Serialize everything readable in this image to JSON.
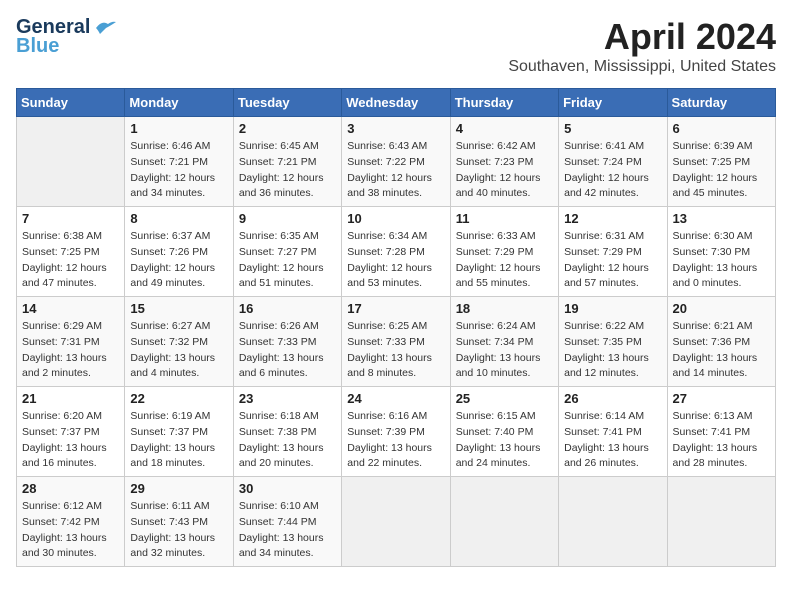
{
  "logo": {
    "line1": "General",
    "line2": "Blue"
  },
  "title": "April 2024",
  "subtitle": "Southaven, Mississippi, United States",
  "weekdays": [
    "Sunday",
    "Monday",
    "Tuesday",
    "Wednesday",
    "Thursday",
    "Friday",
    "Saturday"
  ],
  "weeks": [
    [
      {
        "day": "",
        "sunrise": "",
        "sunset": "",
        "daylight": ""
      },
      {
        "day": "1",
        "sunrise": "Sunrise: 6:46 AM",
        "sunset": "Sunset: 7:21 PM",
        "daylight": "Daylight: 12 hours and 34 minutes."
      },
      {
        "day": "2",
        "sunrise": "Sunrise: 6:45 AM",
        "sunset": "Sunset: 7:21 PM",
        "daylight": "Daylight: 12 hours and 36 minutes."
      },
      {
        "day": "3",
        "sunrise": "Sunrise: 6:43 AM",
        "sunset": "Sunset: 7:22 PM",
        "daylight": "Daylight: 12 hours and 38 minutes."
      },
      {
        "day": "4",
        "sunrise": "Sunrise: 6:42 AM",
        "sunset": "Sunset: 7:23 PM",
        "daylight": "Daylight: 12 hours and 40 minutes."
      },
      {
        "day": "5",
        "sunrise": "Sunrise: 6:41 AM",
        "sunset": "Sunset: 7:24 PM",
        "daylight": "Daylight: 12 hours and 42 minutes."
      },
      {
        "day": "6",
        "sunrise": "Sunrise: 6:39 AM",
        "sunset": "Sunset: 7:25 PM",
        "daylight": "Daylight: 12 hours and 45 minutes."
      }
    ],
    [
      {
        "day": "7",
        "sunrise": "Sunrise: 6:38 AM",
        "sunset": "Sunset: 7:25 PM",
        "daylight": "Daylight: 12 hours and 47 minutes."
      },
      {
        "day": "8",
        "sunrise": "Sunrise: 6:37 AM",
        "sunset": "Sunset: 7:26 PM",
        "daylight": "Daylight: 12 hours and 49 minutes."
      },
      {
        "day": "9",
        "sunrise": "Sunrise: 6:35 AM",
        "sunset": "Sunset: 7:27 PM",
        "daylight": "Daylight: 12 hours and 51 minutes."
      },
      {
        "day": "10",
        "sunrise": "Sunrise: 6:34 AM",
        "sunset": "Sunset: 7:28 PM",
        "daylight": "Daylight: 12 hours and 53 minutes."
      },
      {
        "day": "11",
        "sunrise": "Sunrise: 6:33 AM",
        "sunset": "Sunset: 7:29 PM",
        "daylight": "Daylight: 12 hours and 55 minutes."
      },
      {
        "day": "12",
        "sunrise": "Sunrise: 6:31 AM",
        "sunset": "Sunset: 7:29 PM",
        "daylight": "Daylight: 12 hours and 57 minutes."
      },
      {
        "day": "13",
        "sunrise": "Sunrise: 6:30 AM",
        "sunset": "Sunset: 7:30 PM",
        "daylight": "Daylight: 13 hours and 0 minutes."
      }
    ],
    [
      {
        "day": "14",
        "sunrise": "Sunrise: 6:29 AM",
        "sunset": "Sunset: 7:31 PM",
        "daylight": "Daylight: 13 hours and 2 minutes."
      },
      {
        "day": "15",
        "sunrise": "Sunrise: 6:27 AM",
        "sunset": "Sunset: 7:32 PM",
        "daylight": "Daylight: 13 hours and 4 minutes."
      },
      {
        "day": "16",
        "sunrise": "Sunrise: 6:26 AM",
        "sunset": "Sunset: 7:33 PM",
        "daylight": "Daylight: 13 hours and 6 minutes."
      },
      {
        "day": "17",
        "sunrise": "Sunrise: 6:25 AM",
        "sunset": "Sunset: 7:33 PM",
        "daylight": "Daylight: 13 hours and 8 minutes."
      },
      {
        "day": "18",
        "sunrise": "Sunrise: 6:24 AM",
        "sunset": "Sunset: 7:34 PM",
        "daylight": "Daylight: 13 hours and 10 minutes."
      },
      {
        "day": "19",
        "sunrise": "Sunrise: 6:22 AM",
        "sunset": "Sunset: 7:35 PM",
        "daylight": "Daylight: 13 hours and 12 minutes."
      },
      {
        "day": "20",
        "sunrise": "Sunrise: 6:21 AM",
        "sunset": "Sunset: 7:36 PM",
        "daylight": "Daylight: 13 hours and 14 minutes."
      }
    ],
    [
      {
        "day": "21",
        "sunrise": "Sunrise: 6:20 AM",
        "sunset": "Sunset: 7:37 PM",
        "daylight": "Daylight: 13 hours and 16 minutes."
      },
      {
        "day": "22",
        "sunrise": "Sunrise: 6:19 AM",
        "sunset": "Sunset: 7:37 PM",
        "daylight": "Daylight: 13 hours and 18 minutes."
      },
      {
        "day": "23",
        "sunrise": "Sunrise: 6:18 AM",
        "sunset": "Sunset: 7:38 PM",
        "daylight": "Daylight: 13 hours and 20 minutes."
      },
      {
        "day": "24",
        "sunrise": "Sunrise: 6:16 AM",
        "sunset": "Sunset: 7:39 PM",
        "daylight": "Daylight: 13 hours and 22 minutes."
      },
      {
        "day": "25",
        "sunrise": "Sunrise: 6:15 AM",
        "sunset": "Sunset: 7:40 PM",
        "daylight": "Daylight: 13 hours and 24 minutes."
      },
      {
        "day": "26",
        "sunrise": "Sunrise: 6:14 AM",
        "sunset": "Sunset: 7:41 PM",
        "daylight": "Daylight: 13 hours and 26 minutes."
      },
      {
        "day": "27",
        "sunrise": "Sunrise: 6:13 AM",
        "sunset": "Sunset: 7:41 PM",
        "daylight": "Daylight: 13 hours and 28 minutes."
      }
    ],
    [
      {
        "day": "28",
        "sunrise": "Sunrise: 6:12 AM",
        "sunset": "Sunset: 7:42 PM",
        "daylight": "Daylight: 13 hours and 30 minutes."
      },
      {
        "day": "29",
        "sunrise": "Sunrise: 6:11 AM",
        "sunset": "Sunset: 7:43 PM",
        "daylight": "Daylight: 13 hours and 32 minutes."
      },
      {
        "day": "30",
        "sunrise": "Sunrise: 6:10 AM",
        "sunset": "Sunset: 7:44 PM",
        "daylight": "Daylight: 13 hours and 34 minutes."
      },
      {
        "day": "",
        "sunrise": "",
        "sunset": "",
        "daylight": ""
      },
      {
        "day": "",
        "sunrise": "",
        "sunset": "",
        "daylight": ""
      },
      {
        "day": "",
        "sunrise": "",
        "sunset": "",
        "daylight": ""
      },
      {
        "day": "",
        "sunrise": "",
        "sunset": "",
        "daylight": ""
      }
    ]
  ]
}
